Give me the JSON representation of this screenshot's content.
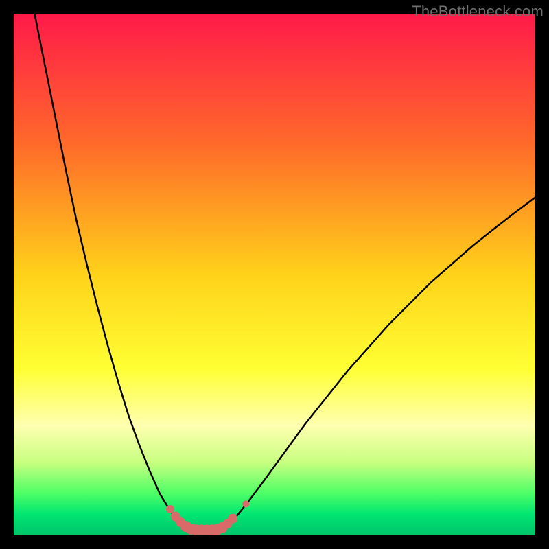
{
  "watermark": {
    "text": "TheBottleneck.com"
  },
  "chart_data": {
    "type": "line",
    "title": "",
    "xlabel": "",
    "ylabel": "",
    "xlim": [
      0,
      100
    ],
    "ylim": [
      0,
      100
    ],
    "grid": false,
    "legend": false,
    "background_gradient": {
      "stops": [
        {
          "offset": 0.0,
          "color": "#ff1a49"
        },
        {
          "offset": 0.25,
          "color": "#ff6a2a"
        },
        {
          "offset": 0.5,
          "color": "#ffd21a"
        },
        {
          "offset": 0.68,
          "color": "#ffff33"
        },
        {
          "offset": 0.79,
          "color": "#ffffb0"
        },
        {
          "offset": 0.86,
          "color": "#c8ff80"
        },
        {
          "offset": 0.92,
          "color": "#4dff66"
        },
        {
          "offset": 0.96,
          "color": "#00e572"
        },
        {
          "offset": 1.0,
          "color": "#00c46a"
        }
      ]
    },
    "series": [
      {
        "name": "left-branch",
        "color": "#000000",
        "width": 2.5,
        "x": [
          4,
          6,
          8,
          10,
          12,
          14,
          16,
          18,
          20,
          22,
          24,
          26,
          28,
          29.5,
          30.5,
          31.5,
          32.5,
          33.5,
          34.5
        ],
        "y": [
          100,
          90,
          80,
          70,
          60.5,
          52,
          44,
          36.5,
          29.5,
          23,
          17.5,
          12.5,
          8,
          5.5,
          4,
          3,
          2.2,
          1.6,
          1.2
        ]
      },
      {
        "name": "right-branch",
        "color": "#000000",
        "width": 2.5,
        "x": [
          39.5,
          40.5,
          41.5,
          43,
          45,
          48,
          52,
          56,
          60,
          64,
          68,
          72,
          76,
          80,
          84,
          88,
          92,
          96,
          100
        ],
        "y": [
          1.2,
          1.7,
          2.5,
          4,
          6.5,
          10.5,
          16,
          21.5,
          26.5,
          31.5,
          36,
          40.5,
          44.5,
          48.5,
          52,
          55.5,
          58.7,
          61.8,
          64.8
        ]
      },
      {
        "name": "valley-floor",
        "color": "#000000",
        "width": 2.0,
        "x": [
          34.5,
          35.5,
          36.5,
          37.5,
          38.5,
          39.5
        ],
        "y": [
          1.2,
          1.0,
          1.0,
          1.0,
          1.0,
          1.2
        ]
      }
    ],
    "markers": [
      {
        "x": 30.0,
        "y": 5.0,
        "r": 6,
        "color": "#d86a6a"
      },
      {
        "x": 31.0,
        "y": 3.6,
        "r": 7,
        "color": "#d86a6a"
      },
      {
        "x": 32.0,
        "y": 2.5,
        "r": 7,
        "color": "#d86a6a"
      },
      {
        "x": 33.0,
        "y": 1.7,
        "r": 8,
        "color": "#d86a6a"
      },
      {
        "x": 34.0,
        "y": 1.2,
        "r": 8,
        "color": "#d86a6a"
      },
      {
        "x": 35.0,
        "y": 1.0,
        "r": 8,
        "color": "#d86a6a"
      },
      {
        "x": 36.0,
        "y": 1.0,
        "r": 8,
        "color": "#d86a6a"
      },
      {
        "x": 37.0,
        "y": 1.0,
        "r": 8,
        "color": "#d86a6a"
      },
      {
        "x": 38.0,
        "y": 1.0,
        "r": 8,
        "color": "#d86a6a"
      },
      {
        "x": 39.0,
        "y": 1.1,
        "r": 8,
        "color": "#d86a6a"
      },
      {
        "x": 40.0,
        "y": 1.5,
        "r": 8,
        "color": "#d86a6a"
      },
      {
        "x": 41.0,
        "y": 2.2,
        "r": 7,
        "color": "#d86a6a"
      },
      {
        "x": 42.0,
        "y": 3.2,
        "r": 7,
        "color": "#d86a6a"
      },
      {
        "x": 44.5,
        "y": 6.0,
        "r": 5,
        "color": "#d86a6a"
      }
    ]
  }
}
